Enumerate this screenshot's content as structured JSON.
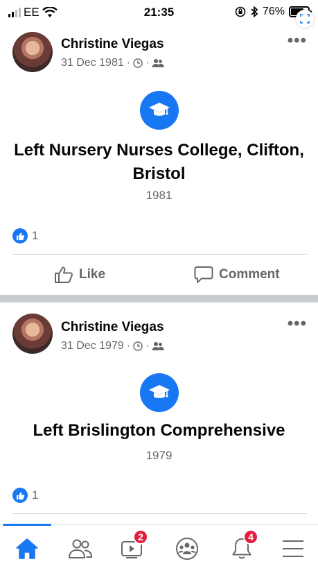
{
  "status_bar": {
    "carrier": "EE",
    "time": "21:35",
    "battery": "76%",
    "battery_level": 0.76
  },
  "posts": [
    {
      "author": "Christine Viegas",
      "date": "31 Dec 1981",
      "event_title": "Left Nursery Nurses College, Clifton, Bristol",
      "event_year": "1981",
      "like_count": "1",
      "like_label": "Like",
      "comment_label": "Comment"
    },
    {
      "author": "Christine Viegas",
      "date": "31 Dec 1979",
      "event_title": "Left Brislington Comprehensive",
      "event_year": "1979",
      "like_count": "1"
    }
  ],
  "bottom_nav": {
    "watch_badge": "2",
    "notifications_badge": "4"
  },
  "colors": {
    "brand_blue": "#1877f2",
    "badge_red": "#e41e3f",
    "secondary_text": "#65676b"
  },
  "icons": [
    "graduation-cap-icon",
    "thumbs-up-icon",
    "comment-icon",
    "home-icon",
    "friends-icon",
    "watch-icon",
    "groups-icon",
    "bell-icon",
    "menu-icon",
    "clock-icon",
    "friends-audience-icon",
    "more-icon"
  ]
}
